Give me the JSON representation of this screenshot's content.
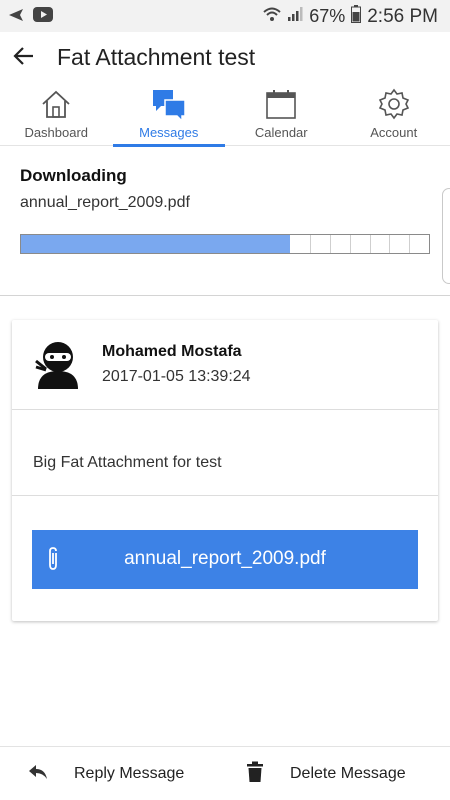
{
  "status_bar": {
    "battery": "67%",
    "time": "2:56 PM"
  },
  "app_bar": {
    "title": "Fat Attachment test",
    "back_icon": "arrow-left-icon"
  },
  "tabs": [
    {
      "label": "Dashboard",
      "icon": "home-icon",
      "active": false
    },
    {
      "label": "Messages",
      "icon": "chat-icon",
      "active": true
    },
    {
      "label": "Calendar",
      "icon": "calendar-icon",
      "active": false
    },
    {
      "label": "Account",
      "icon": "gear-icon",
      "active": false
    }
  ],
  "download": {
    "title": "Downloading",
    "filename": "annual_report_2009.pdf",
    "progress": 0.66,
    "segments_remaining": 7
  },
  "message": {
    "sender": "Mohamed Mostafa",
    "timestamp": "2017-01-05 13:39:24",
    "body": "Big Fat Attachment for test",
    "attachment": {
      "filename": "annual_report_2009.pdf",
      "icon": "paperclip-icon"
    }
  },
  "bottom_bar": {
    "reply_label": "Reply Message",
    "delete_label": "Delete Message"
  },
  "colors": {
    "accent": "#2f7be6",
    "progress_fill": "#7aa8ef",
    "attachment_button": "#3d82e6"
  }
}
